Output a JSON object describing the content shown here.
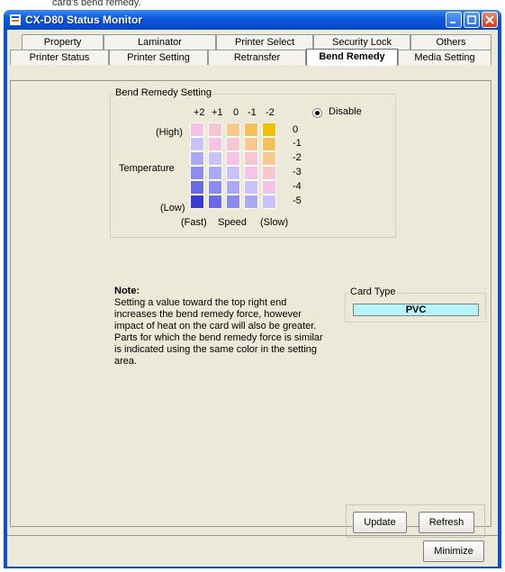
{
  "caption": "card's bend remedy.",
  "window": {
    "title": "CX-D80 Status Monitor"
  },
  "tabs_row1": [
    {
      "label": "Property"
    },
    {
      "label": "Laminator"
    },
    {
      "label": "Printer Select"
    },
    {
      "label": "Security Lock"
    },
    {
      "label": "Others"
    }
  ],
  "tabs_row2": [
    {
      "label": "Printer Status"
    },
    {
      "label": "Printer Setting"
    },
    {
      "label": "Retransfer"
    },
    {
      "label": "Bend Remedy",
      "selected": true
    },
    {
      "label": "Media Setting"
    }
  ],
  "bend": {
    "group_label": "Bend Remedy Setting",
    "speed_ticks": [
      "+2",
      "+1",
      "0",
      "-1",
      "-2"
    ],
    "temp_ticks": [
      "0",
      "-1",
      "-2",
      "-3",
      "-4",
      "-5"
    ],
    "high_label": "(High)",
    "temperature_label": "Temperature",
    "low_label": "(Low)",
    "fast_label": "(Fast)",
    "speed_label": "Speed",
    "slow_label": "(Slow)",
    "disable_label": "Disable",
    "disable_selected": true,
    "grid_colors": [
      [
        "#f6c2e6",
        "#f7c7d1",
        "#f7c98c",
        "#f5c058",
        "#f1c000"
      ],
      [
        "#c8c2f8",
        "#f6c2e6",
        "#f7c7d1",
        "#f7c98c",
        "#f5c058"
      ],
      [
        "#a9a9f6",
        "#c8c2f8",
        "#f6c2e6",
        "#f7c7d1",
        "#f7c98c"
      ],
      [
        "#8c8cf0",
        "#a9a9f6",
        "#c8c2f8",
        "#f6c2e6",
        "#f7c7d1"
      ],
      [
        "#6a6ae6",
        "#8c8cf0",
        "#a9a9f6",
        "#c8c2f8",
        "#f6c2e6"
      ],
      [
        "#3a3ad4",
        "#6a6ae6",
        "#8c8cf0",
        "#a9a9f6",
        "#c8c2f8"
      ]
    ]
  },
  "note": {
    "title": "Note:",
    "body": "Setting a value toward the top right end increases the bend remedy force, however impact of heat on the card will also be greater.  Parts for which the bend remedy force is similar is indicated using the same color in the setting area."
  },
  "card_type": {
    "label": "Card Type",
    "value": "PVC"
  },
  "buttons": {
    "update": "Update",
    "refresh": "Refresh",
    "minimize": "Minimize"
  },
  "colors": {
    "title_bar": "#0b5ae0",
    "card_field": "#b7f3f9",
    "panel": "#ece9d8"
  }
}
